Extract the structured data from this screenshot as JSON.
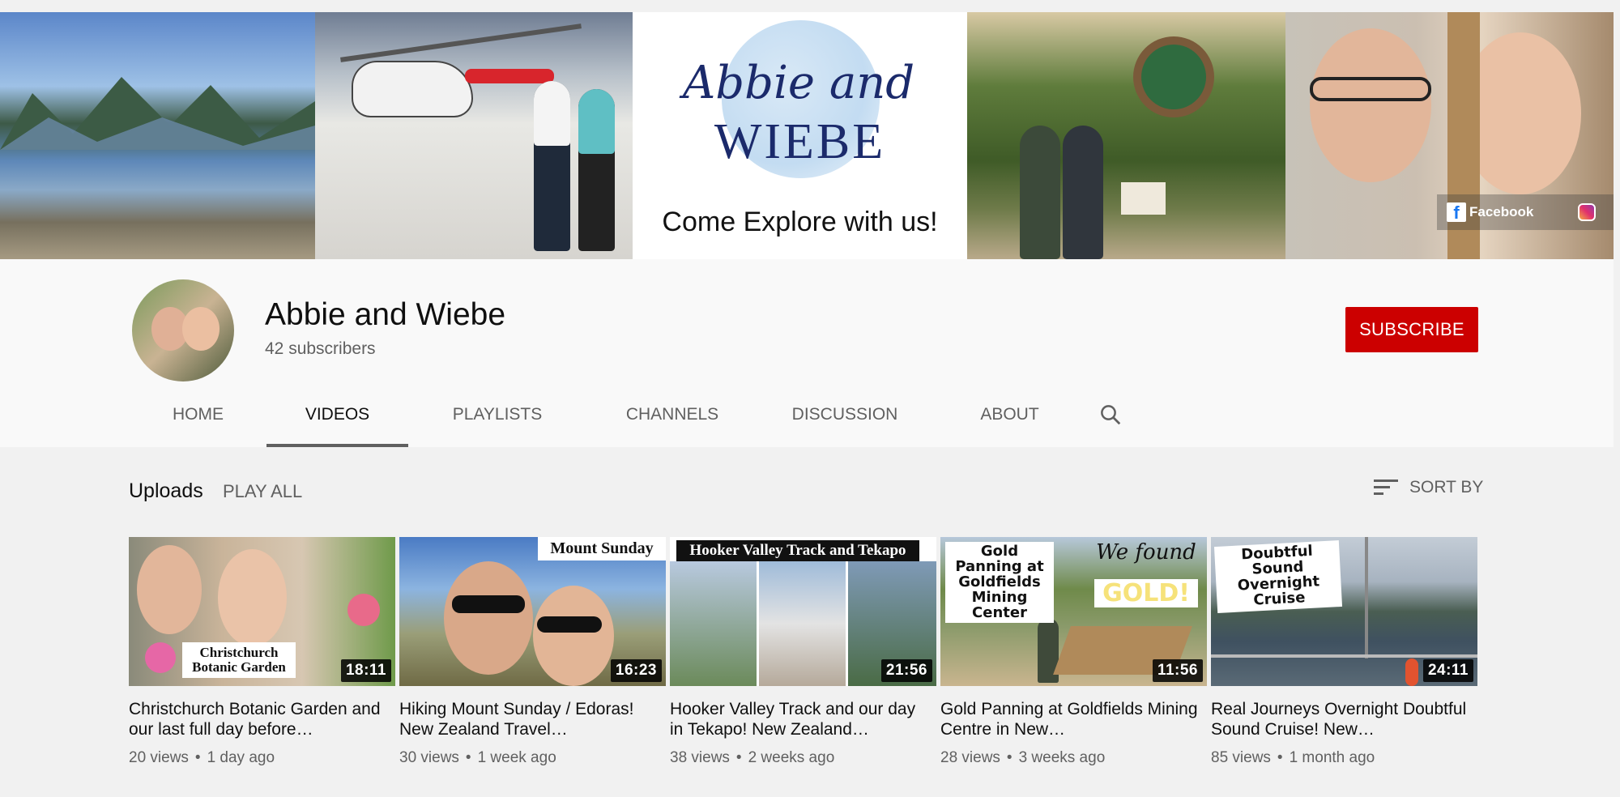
{
  "banner": {
    "logo_script": "Abbie and",
    "logo_caps": "WIEBE",
    "tagline": "Come Explore with us!",
    "social_facebook": "Facebook",
    "icons": [
      "facebook-icon",
      "instagram-icon"
    ]
  },
  "channel": {
    "name": "Abbie and Wiebe",
    "subscribers": "42 subscribers",
    "subscribe_label": "SUBSCRIBE"
  },
  "tabs": [
    {
      "label": "HOME",
      "active": false
    },
    {
      "label": "VIDEOS",
      "active": true
    },
    {
      "label": "PLAYLISTS",
      "active": false
    },
    {
      "label": "CHANNELS",
      "active": false
    },
    {
      "label": "DISCUSSION",
      "active": false
    },
    {
      "label": "ABOUT",
      "active": false
    }
  ],
  "uploads": {
    "title": "Uploads",
    "play_all": "PLAY ALL",
    "sort_label": "SORT BY"
  },
  "videos": [
    {
      "title": "Christchurch Botanic Garden and our last full day before…",
      "views": "20 views",
      "age": "1 day ago",
      "duration": "18:11",
      "thumb_caption": "Christchurch Botanic Garden"
    },
    {
      "title": "Hiking Mount Sunday / Edoras! New Zealand Travel…",
      "views": "30 views",
      "age": "1 week ago",
      "duration": "16:23",
      "thumb_caption": "Mount Sunday"
    },
    {
      "title": "Hooker Valley Track and our day in Tekapo! New Zealand…",
      "views": "38 views",
      "age": "2 weeks ago",
      "duration": "21:56",
      "thumb_caption": "Hooker Valley Track and Tekapo"
    },
    {
      "title": "Gold Panning at Goldfields Mining Centre in New…",
      "views": "28 views",
      "age": "3 weeks ago",
      "duration": "11:56",
      "thumb_caption": "Gold Panning at Goldfields Mining Center",
      "thumb_caption_2": "We found",
      "thumb_caption_3": "GOLD!"
    },
    {
      "title": "Real Journeys Overnight Doubtful Sound Cruise! New…",
      "views": "85 views",
      "age": "1 month ago",
      "duration": "24:11",
      "thumb_caption": "Doubtful Sound Overnight Cruise"
    }
  ],
  "colors": {
    "subscribe": "#cc0000",
    "tab_indicator": "#606060",
    "background": "#f1f1f1"
  }
}
